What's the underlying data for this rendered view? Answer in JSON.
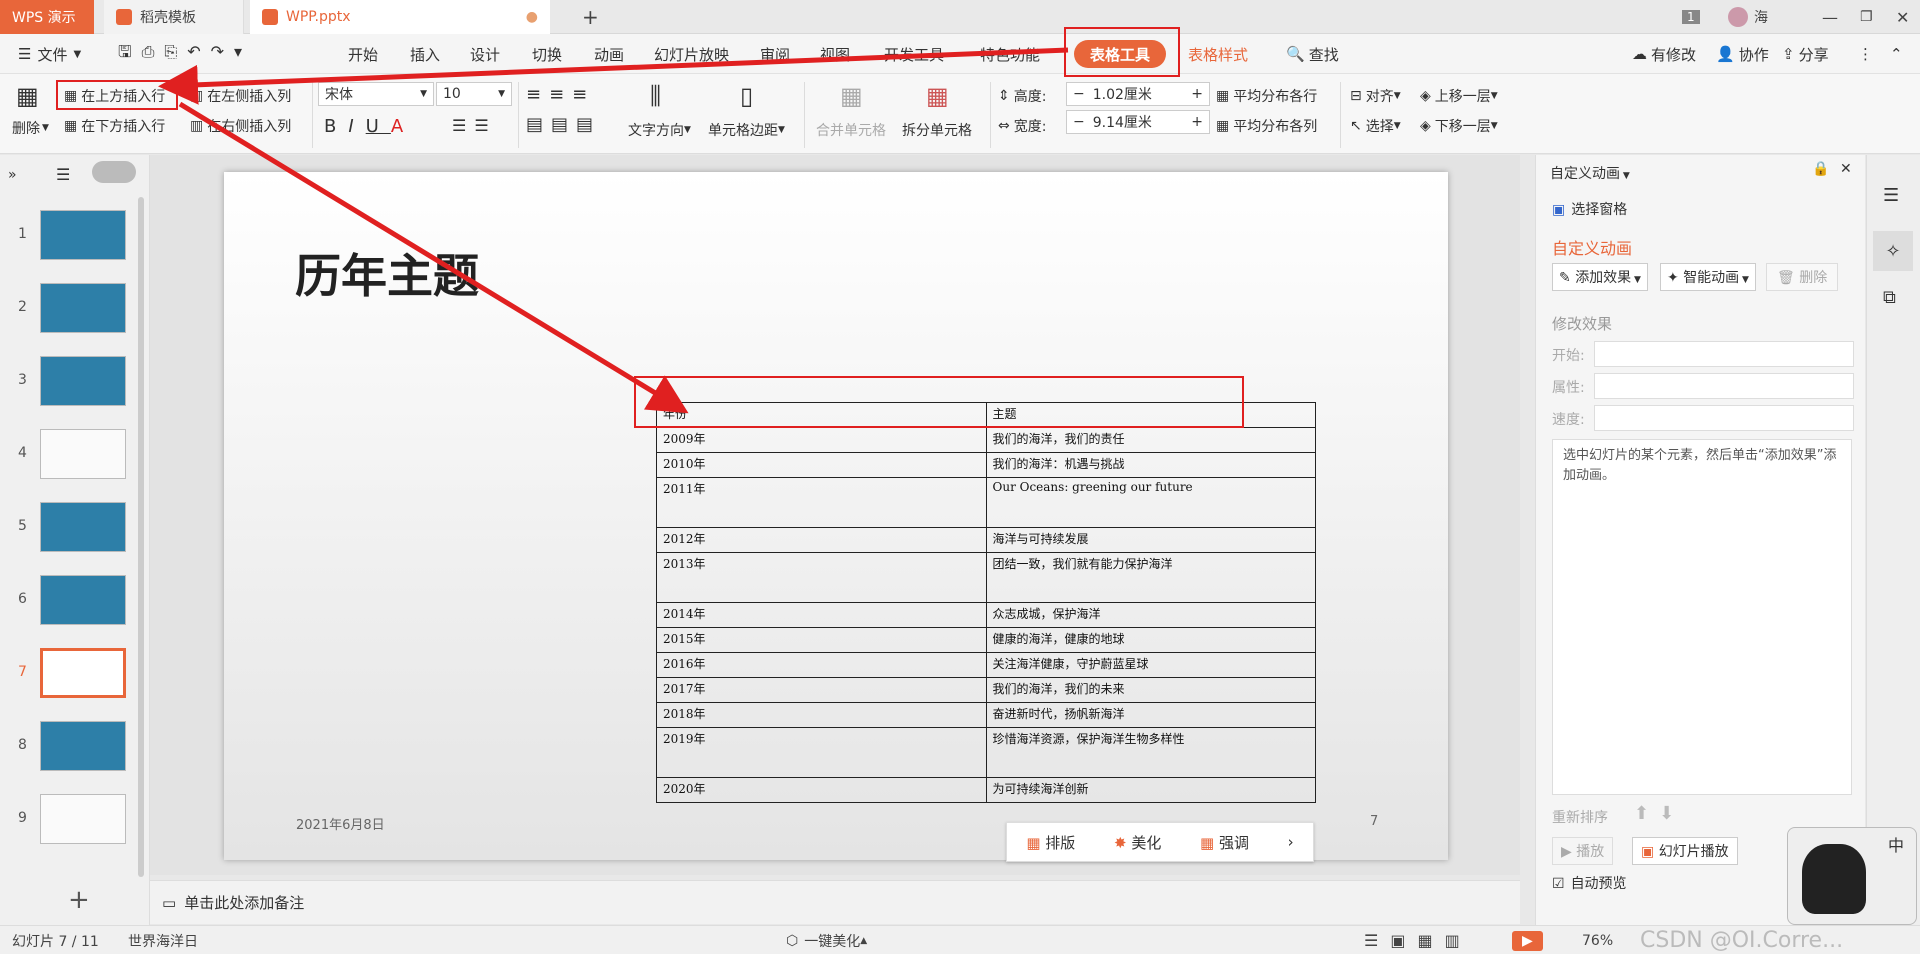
{
  "tabs": {
    "wps": "WPS 演示",
    "daoke": "稻壳模板",
    "file": "WPP.pptx",
    "new": "+"
  },
  "titlebar_right": {
    "badge": "1",
    "user": "海"
  },
  "menu": {
    "file": "文件",
    "items": [
      "开始",
      "插入",
      "设计",
      "切换",
      "动画",
      "幻灯片放映",
      "审阅",
      "视图",
      "开发工具",
      "特色功能"
    ],
    "table_tools": "表格工具",
    "table_style": "表格样式",
    "search": "查找",
    "right": [
      "有修改",
      "协作",
      "分享"
    ]
  },
  "toolbar": {
    "delete": "删除",
    "insert_above": "在上方插入行",
    "insert_below": "在下方插入行",
    "insert_left": "在左侧插入列",
    "insert_right": "在右侧插入列",
    "font": "宋体",
    "size": "10",
    "text_dir": "文字方向",
    "cell_margin": "单元格边距",
    "merge": "合并单元格",
    "split": "拆分单元格",
    "height_label": "高度:",
    "height_val": "1.02厘米",
    "width_label": "宽度:",
    "width_val": "9.14厘米",
    "dist_rows": "平均分布各行",
    "dist_cols": "平均分布各列",
    "align": "对齐",
    "select": "选择",
    "up": "上移一层",
    "down": "下移一层"
  },
  "slides": [
    "1",
    "2",
    "3",
    "4",
    "5",
    "6",
    "7",
    "8",
    "9"
  ],
  "slide": {
    "title": "历年主题",
    "date": "2021年6月8日",
    "page": "7",
    "table_header": [
      "年份",
      "主题"
    ],
    "rows": [
      [
        "2009年",
        "我们的海洋，我们的责任"
      ],
      [
        "2010年",
        "我们的海洋：机遇与挑战"
      ],
      [
        "2011年",
        "Our Oceans: greening our future"
      ],
      [
        "2012年",
        "海洋与可持续发展"
      ],
      [
        "2013年",
        "团结一致，我们就有能力保护海洋"
      ],
      [
        "2014年",
        "众志成城，保护海洋"
      ],
      [
        "2015年",
        "健康的海洋，健康的地球"
      ],
      [
        "2016年",
        "关注海洋健康，守护蔚蓝星球"
      ],
      [
        "2017年",
        "我们的海洋，我们的未来"
      ],
      [
        "2018年",
        "奋进新时代，扬帆新海洋"
      ],
      [
        "2019年",
        "珍惜海洋资源，保护海洋生物多样性"
      ],
      [
        "2020年",
        "为可持续海洋创新"
      ]
    ],
    "float_bar": [
      "排版",
      "美化",
      "强调"
    ]
  },
  "notes": "单击此处添加备注",
  "right_panel": {
    "header": "自定义动画",
    "select_pane": "选择窗格",
    "section": "自定义动画",
    "add_effect": "添加效果",
    "smart_anim": "智能动画",
    "delete": "删除",
    "modify": "修改效果",
    "start": "开始:",
    "property": "属性:",
    "speed": "速度:",
    "hint": "选中幻灯片的某个元素，然后单击“添加效果”添加动画。",
    "reorder": "重新排序",
    "play": "播放",
    "slideshow": "幻灯片播放",
    "autopreview": "自动预览"
  },
  "status": {
    "slide": "幻灯片 7 / 11",
    "theme": "世界海洋日",
    "beautify": "一键美化",
    "zoom": "76%",
    "watermark": "CSDN @OI.Corre..."
  },
  "colors": {
    "accent": "#e8663a",
    "annot": "#e02020"
  }
}
